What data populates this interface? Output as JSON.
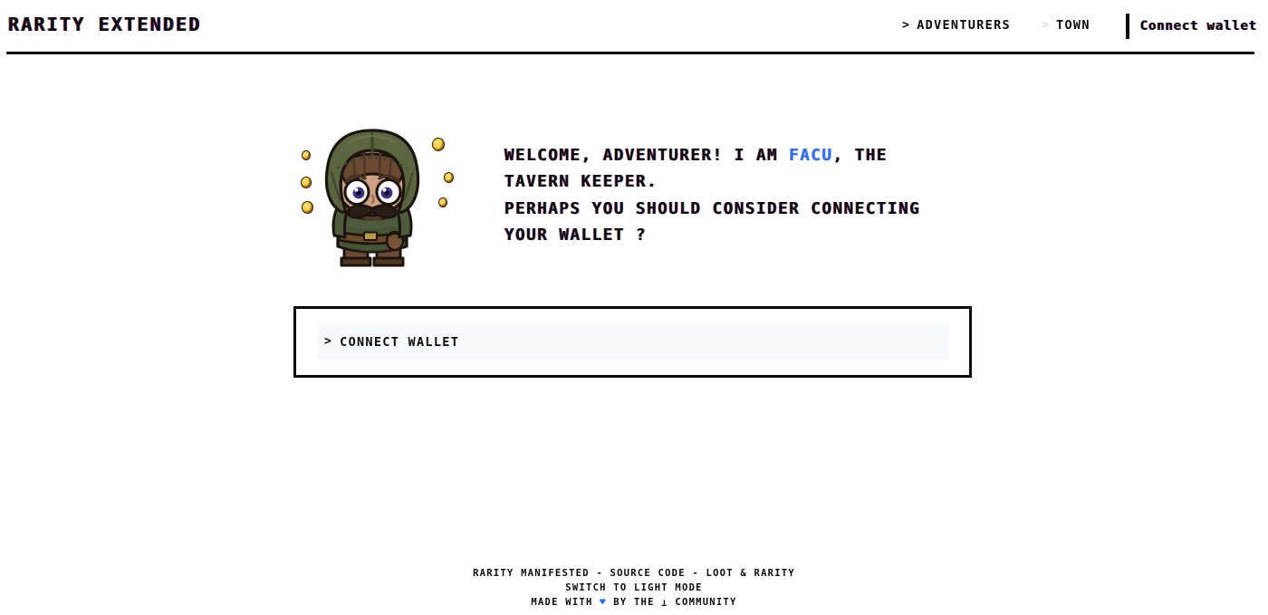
{
  "header": {
    "brand": "RARITY EXTENDED",
    "nav": [
      {
        "label": "ADVENTURERS",
        "chevron": "chevron-right-icon",
        "chevron_state": "dark"
      },
      {
        "label": "TOWN",
        "chevron": "chevron-right-icon",
        "chevron_state": "light"
      }
    ],
    "wallet_button": "Connect wallet"
  },
  "hero": {
    "avatar": {
      "name": "tavern-keeper-sprite",
      "coins": 6
    },
    "speech": {
      "line1_a": "WELCOME, ADVENTURER! I AM ",
      "line1_highlight": "FACU",
      "line1_b": ", THE",
      "line2": "TAVERN KEEPER.",
      "line3": "PERHAPS YOU SHOULD CONSIDER CONNECTING",
      "line4": "YOUR WALLET ?"
    }
  },
  "panel": {
    "connect_label": "CONNECT WALLET",
    "connect_chevron": ">"
  },
  "footer": {
    "links_line": "RARITY MANIFESTED - SOURCE CODE - LOOT & RARITY",
    "theme_toggle": "SWITCH TO LIGHT MODE",
    "credit_prefix": "MADE WITH ",
    "credit_heart": "♥",
    "credit_middle": " BY THE ",
    "credit_mark": "⊥",
    "credit_suffix": " COMMUNITY"
  },
  "colors": {
    "accent_blue": "#2f6ef0",
    "ink": "#0b0b0b",
    "panel_row_bg": "#f7f8fa",
    "chevron_muted": "#dedede"
  }
}
